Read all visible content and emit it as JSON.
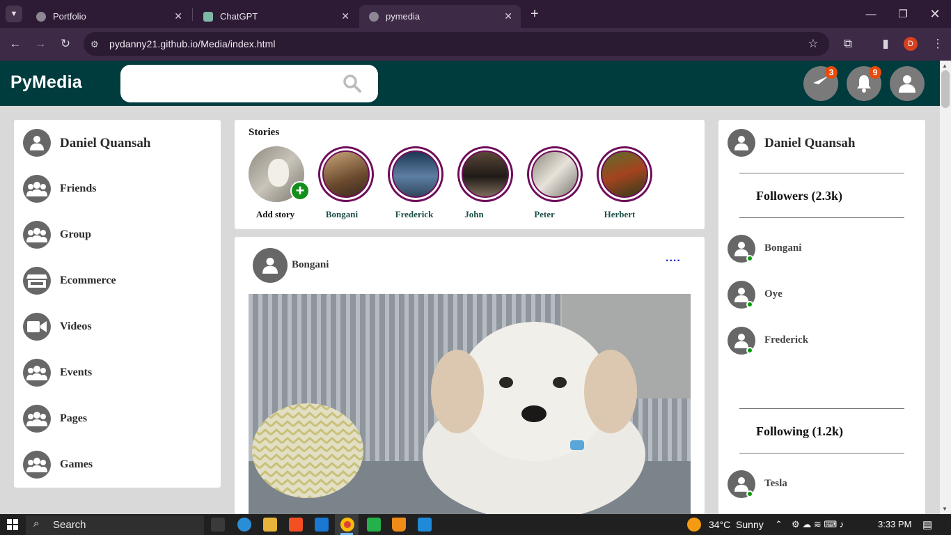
{
  "browser": {
    "tabs": [
      {
        "title": "Portfolio"
      },
      {
        "title": "ChatGPT"
      },
      {
        "title": "pymedia"
      }
    ],
    "url": "pydanny21.github.io/Media/index.html",
    "profile_initial": "D"
  },
  "header": {
    "logo": "PyMedia",
    "search_placeholder": "",
    "messages_badge": "3",
    "notifications_badge": "9"
  },
  "sidebar": {
    "user_name": "Daniel Quansah",
    "items": [
      {
        "label": "Friends",
        "icon": "group-icon"
      },
      {
        "label": "Group",
        "icon": "group-icon"
      },
      {
        "label": "Ecommerce",
        "icon": "store-icon"
      },
      {
        "label": "Videos",
        "icon": "video-icon"
      },
      {
        "label": "Events",
        "icon": "group-icon"
      },
      {
        "label": "Pages",
        "icon": "group-icon"
      },
      {
        "label": "Games",
        "icon": "group-icon"
      }
    ]
  },
  "stories": {
    "heading": "Stories",
    "add_label": "Add story",
    "people": [
      "Bongani",
      "Frederick",
      "John",
      "Peter",
      "Herbert"
    ]
  },
  "post": {
    "author": "Bongani",
    "menu": "...."
  },
  "rightbar": {
    "user_name": "Daniel Quansah",
    "followers_heading": "Followers (2.3k)",
    "followers": [
      "Bongani",
      "Oye",
      "Frederick"
    ],
    "following_heading": "Following (1.2k)",
    "following": [
      "Tesla"
    ]
  },
  "taskbar": {
    "search": "Search",
    "weather": "34°C  Sunny",
    "time": "3:33 PM"
  },
  "colors": {
    "header_bg": "#003b3d",
    "story_ring": "#6e0d5a",
    "online": "#0a9a0a",
    "badge": "#e74c0c"
  }
}
